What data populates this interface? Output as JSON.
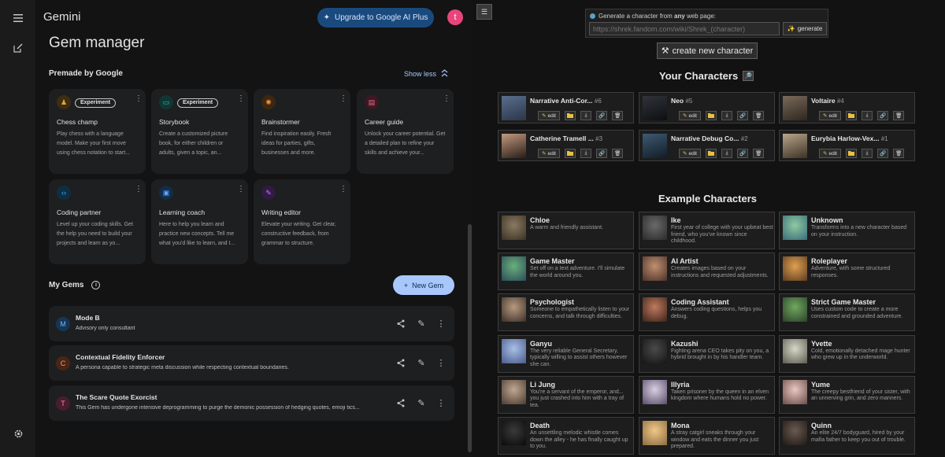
{
  "gemini": {
    "brand": "Gemini",
    "upgrade_label": "Upgrade to Google AI Plus",
    "avatar_initial": "t",
    "page_title": "Gem manager",
    "premade_title": "Premade by Google",
    "show_less_label": "Show less",
    "premade": [
      {
        "title": "Chess champ",
        "badge": "Experiment",
        "desc": "Play chess with a language model. Make your first move using chess notation to start...",
        "icon": "pawn-icon",
        "color": "#e8a33a",
        "bg": "#3d2e12"
      },
      {
        "title": "Storybook",
        "badge": "Experiment",
        "desc": "Create a customized picture book, for either children or adults, given a topic, an...",
        "icon": "book-icon",
        "color": "#3cbfbd",
        "bg": "#113634"
      },
      {
        "title": "Brainstormer",
        "badge": "",
        "desc": "Find inspiration easily. Fresh ideas for parties, gifts, businesses and more.",
        "icon": "lightbulb-icon",
        "color": "#f0943e",
        "bg": "#3d2712"
      },
      {
        "title": "Career guide",
        "badge": "",
        "desc": "Unlock your career potential. Get a detailed plan to refine your skills and achieve your...",
        "icon": "briefcase-icon",
        "color": "#ee6b8c",
        "bg": "#3d1822"
      },
      {
        "title": "Coding partner",
        "badge": "",
        "desc": "Level up your coding skills. Get the help you need to build your projects and learn as yo...",
        "icon": "code-icon",
        "color": "#4fb7ff",
        "bg": "#0e2e44"
      },
      {
        "title": "Learning coach",
        "badge": "",
        "desc": "Here to help you learn and practice new concepts. Tell me what you'd like to learn, and I...",
        "icon": "book-open-icon",
        "color": "#5aa8ff",
        "bg": "#142c4a"
      },
      {
        "title": "Writing editor",
        "badge": "",
        "desc": "Elevate your writing. Get clear, constructive feedback, from grammar to structure.",
        "icon": "pencil-icon",
        "color": "#c57bff",
        "bg": "#311a44"
      }
    ],
    "my_gems_title": "My Gems",
    "new_gem_label": "New Gem",
    "my_gems": [
      {
        "initial": "M",
        "title": "Mode B",
        "desc": "Advisory only consultant",
        "color": "#6ab4ff",
        "bg": "#163656"
      },
      {
        "initial": "C",
        "title": "Contextual Fidelity Enforcer",
        "desc": "A persona capable to strategic meta discussion while respecting contextual boundaries.",
        "color": "#f29c6b",
        "bg": "#4a2516"
      },
      {
        "initial": "T",
        "title": "The Scare Quote Exorcist",
        "desc": "This Gem has undergone intensive deprogramming to purge the demonic possession of hedging quotes, emoji tics...",
        "color": "#f08cae",
        "bg": "#4a1d2c"
      }
    ]
  },
  "chars": {
    "gen_label_pre": "Generate a character from ",
    "gen_label_em": "any",
    "gen_label_post": " web page:",
    "gen_placeholder": "https://shrek.fandom.com/wiki/Shrek_(character)",
    "gen_button": "generate",
    "create_button": "create new character",
    "your_title": "Your Characters",
    "edit_label": "edit",
    "your": [
      {
        "name": "Narrative Anti-Cor...",
        "num": "#6",
        "c1": "#5a6f8e",
        "c2": "#2a3548"
      },
      {
        "name": "Neo",
        "num": "#5",
        "c1": "#30333a",
        "c2": "#0d0f12"
      },
      {
        "name": "Voltaire",
        "num": "#4",
        "c1": "#7a6a5a",
        "c2": "#2e261f"
      },
      {
        "name": "Catherine Tramell ...",
        "num": "#3",
        "c1": "#c29a80",
        "c2": "#2a1c16"
      },
      {
        "name": "Narrative Debug Co...",
        "num": "#2",
        "c1": "#3d5a72",
        "c2": "#121c26"
      },
      {
        "name": "Eurybia Harlow-Vex...",
        "num": "#1",
        "c1": "#b8a58a",
        "c2": "#3d3226"
      }
    ],
    "example_title": "Example Characters",
    "examples": [
      {
        "name": "Chloe",
        "desc": "A warm and friendly assistant.",
        "c1": "#8a7a62",
        "c2": "#3a3124"
      },
      {
        "name": "Ike",
        "desc": "First year of college with your upbeat best friend, who you've known since childhood.",
        "c1": "#6a6a6a",
        "c2": "#2a2a2a"
      },
      {
        "name": "Unknown",
        "desc": "Transforms into a new character based on your instruction.",
        "c1": "#8ecaa0",
        "c2": "#3a6a7a"
      },
      {
        "name": "Game Master",
        "desc": "Set off on a text adventure. I'll simulate the world around you.",
        "c1": "#6ab07a",
        "c2": "#2a4a5a"
      },
      {
        "name": "AI Artist",
        "desc": "Creates images based on your instructions and requested adjustments.",
        "c1": "#c09070",
        "c2": "#4a3028"
      },
      {
        "name": "Roleplayer",
        "desc": "Adventure, with some structured responses.",
        "c1": "#e0a050",
        "c2": "#5a3a20"
      },
      {
        "name": "Psychologist",
        "desc": "Someone to empathetically listen to your concerns, and talk through difficulties.",
        "c1": "#b89a80",
        "c2": "#3a2e26"
      },
      {
        "name": "Coding Assistant",
        "desc": "Answers coding questions, helps you debug.",
        "c1": "#c07a60",
        "c2": "#3a2218"
      },
      {
        "name": "Strict Game Master",
        "desc": "Uses custom code to create a more constrained and grounded adventure.",
        "c1": "#70a860",
        "c2": "#2a4028"
      },
      {
        "name": "Ganyu",
        "desc": "The very reliable General Secretary, typically willing to assist others however she can.",
        "c1": "#a8c0e8",
        "c2": "#4a5a8a"
      },
      {
        "name": "Kazushi",
        "desc": "Fighting arena CEO takes pity on you, a hybrid brought in by his handler team.",
        "c1": "#4a4a4a",
        "c2": "#151515"
      },
      {
        "name": "Yvette",
        "desc": "Cold, emotionally detached mage hunter who grew up in the underworld.",
        "c1": "#d8d8c8",
        "c2": "#5a5a50"
      },
      {
        "name": "Li Jung",
        "desc": "You're a servant of the emperor, and... you just crashed into him with a tray of tea.",
        "c1": "#c0a890",
        "c2": "#4a3a30"
      },
      {
        "name": "Illyria",
        "desc": "Taken prisoner by the queen in an elven kingdom where humans hold no power.",
        "c1": "#d8d0e0",
        "c2": "#5a4a6a"
      },
      {
        "name": "Yume",
        "desc": "The creepy bestfriend of your sister, with an unnerving grin, and zero manners.",
        "c1": "#e8c8c0",
        "c2": "#6a4a48"
      },
      {
        "name": "Death",
        "desc": "An unsettling melodic whistle comes down the alley - he has finally caught up to you.",
        "c1": "#3a3a3a",
        "c2": "#0a0a0a"
      },
      {
        "name": "Mona",
        "desc": "A stray catgirl sneaks through your window and eats the dinner you just prepared.",
        "c1": "#f0c888",
        "c2": "#8a6a40"
      },
      {
        "name": "Quinn",
        "desc": "An elite 24/7 bodyguard, hired by your mafia father to keep you out of trouble.",
        "c1": "#6a5a50",
        "c2": "#1e1814"
      }
    ]
  }
}
